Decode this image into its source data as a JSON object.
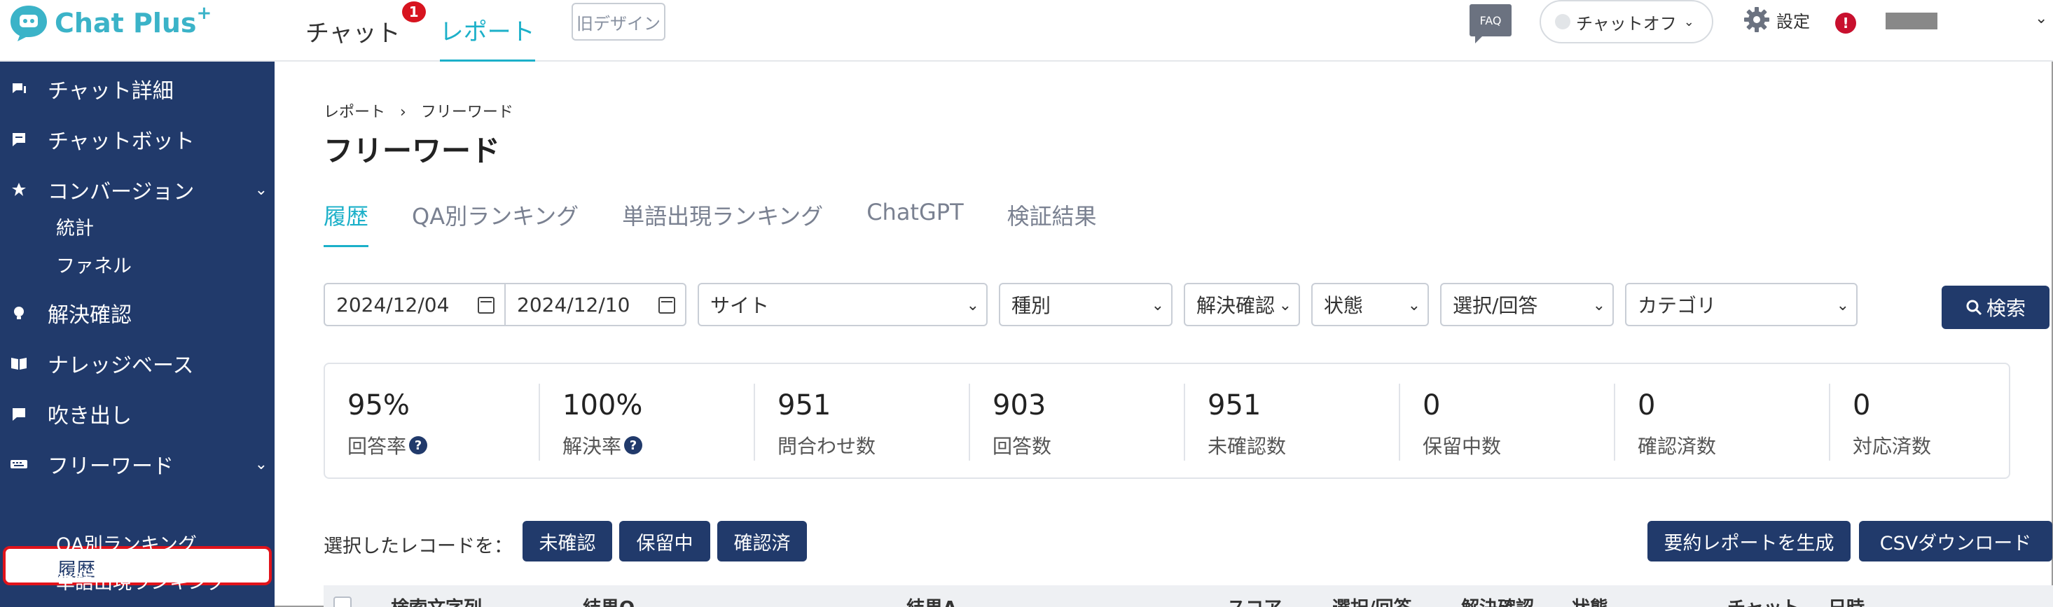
{
  "header": {
    "logo_text": "Chat Plus",
    "logo_plus": "+",
    "nav": [
      {
        "label": "チャット",
        "badge": "1",
        "active": false
      },
      {
        "label": "レポート",
        "active": true
      }
    ],
    "old_design": "旧デザイン",
    "faq": "FAQ",
    "chat_status": "チャットオフ",
    "settings": "設定",
    "alert": "!"
  },
  "sidebar": {
    "items": [
      {
        "label": "チャット詳細",
        "icon": "chat-detail-icon"
      },
      {
        "label": "チャットボット",
        "icon": "chatbot-icon"
      },
      {
        "label": "コンバージョン",
        "icon": "star-icon",
        "expandable": true
      },
      {
        "label": "解決確認",
        "icon": "lightbulb-icon"
      },
      {
        "label": "ナレッジベース",
        "icon": "book-icon"
      },
      {
        "label": "吹き出し",
        "icon": "speech-bubble-icon"
      },
      {
        "label": "フリーワード",
        "icon": "keyboard-icon",
        "expandable": true
      }
    ],
    "conversion_sub": [
      "統計",
      "ファネル"
    ],
    "freeword_sub": [
      "履歴",
      "QA別ランキング",
      "単語出現ランキング"
    ]
  },
  "main": {
    "breadcrumb": [
      "レポート",
      "›",
      "フリーワード"
    ],
    "title": "フリーワード",
    "tabs": [
      "履歴",
      "QA別ランキング",
      "単語出現ランキング",
      "ChatGPT",
      "検証結果"
    ],
    "filters": {
      "date_from": "2024/12/04",
      "date_to": "2024/12/10",
      "site": "サイト",
      "type": "種別",
      "resolution": "解決確認",
      "status": "状態",
      "choice": "選択/回答",
      "category": "カテゴリ",
      "search": "検索"
    },
    "stats": [
      {
        "value": "95%",
        "label": "回答率",
        "help": true
      },
      {
        "value": "100%",
        "label": "解決率",
        "help": true
      },
      {
        "value": "951",
        "label": "問合わせ数"
      },
      {
        "value": "903",
        "label": "回答数"
      },
      {
        "value": "951",
        "label": "未確認数"
      },
      {
        "value": "0",
        "label": "保留中数"
      },
      {
        "value": "0",
        "label": "確認済数"
      },
      {
        "value": "0",
        "label": "対応済数"
      }
    ],
    "actions": {
      "label": "選択したレコードを：",
      "unconfirmed": "未確認",
      "pending": "保留中",
      "confirmed": "確認済",
      "summary_report": "要約レポートを生成",
      "csv": "CSVダウンロード"
    },
    "table_headers": [
      "検索文字列",
      "結果Q",
      "結果A",
      "スコア",
      "選択/回答",
      "解決確認",
      "状態",
      "チャット",
      "日時"
    ]
  }
}
